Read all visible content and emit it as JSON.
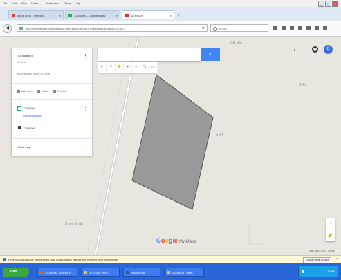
{
  "browser": {
    "menu": [
      "File",
      "Edit",
      "View",
      "History",
      "Bookmarks",
      "Tools",
      "Help"
    ],
    "window_buttons": [
      "_",
      "□",
      "×"
    ],
    "tabs": [
      {
        "label": "Inbox (193) - mshogil…",
        "favicon_color": "#d44638",
        "active": false
      },
      {
        "label": "12000000 - Google Maps",
        "favicon_color": "#34a853",
        "active": false
      },
      {
        "label": "12000000",
        "favicon_color": "#d93025",
        "active": true
      }
    ],
    "new_tab": "+",
    "back": "◀",
    "url": "http://www.google.com/maps/d/?mid=z6uW3krmP0Ls.kKbDwiB-Ao1M8Q&ll=16.3",
    "reload": "⟳",
    "search_placeholder": "Google"
  },
  "map": {
    "labels": {
      "road_top": "SR 96",
      "label_right_top": "S Fe",
      "label_mid": "S Fe",
      "label_bottom": "Sher Shah"
    },
    "polygon_fill": "#999999",
    "polygon_stroke": "#555555",
    "google_logo": "Google",
    "my_maps": "My Maps",
    "attribution": "Map data ©2014 Google",
    "zoom_in": "+",
    "zoom_out": "−",
    "pegman_icon": "pegman-icon"
  },
  "layer_panel": {
    "title": "12000000",
    "views": "1 views",
    "saved": "All changes saved to Drive",
    "actions": [
      "Add layer",
      "Share",
      "Preview"
    ],
    "layer_name": "12000000",
    "style_link": "Individual styles",
    "feature": "12000000",
    "base_map": "Base map",
    "menu": "⋮"
  },
  "map_search": {
    "button_icon": "search-icon",
    "button_glyph": "⌕"
  },
  "draw_tools": [
    "↶",
    "↷",
    "✋",
    "⌖",
    "⌁",
    "⤡",
    "▭"
  ],
  "top_right": {
    "apps_glyph": "⋮⋮⋮",
    "avatar_letter": "C"
  },
  "notification": {
    "message": "Firefox automatically sends some data to Mozilla so that we can improve your experience.",
    "button": "Choose What I Share",
    "close": "×"
  },
  "taskbar": {
    "start": "start",
    "tasks": [
      {
        "label": "12000000 - Mozilla F…",
        "color": "#e66000"
      },
      {
        "label": "D:\\ 12345 PMT\\…",
        "color": "#f1c232"
      },
      {
        "label": "polyline.doc",
        "color": "#2b579a"
      },
      {
        "label": "12000000 - Paint",
        "color": "#f1c232"
      }
    ],
    "clock": "1:12 AM"
  },
  "colors": {
    "accent": "#4285f4",
    "taskbar": "#2b66d9",
    "start": "#3da73d",
    "map_bg": "#e9e6df"
  }
}
